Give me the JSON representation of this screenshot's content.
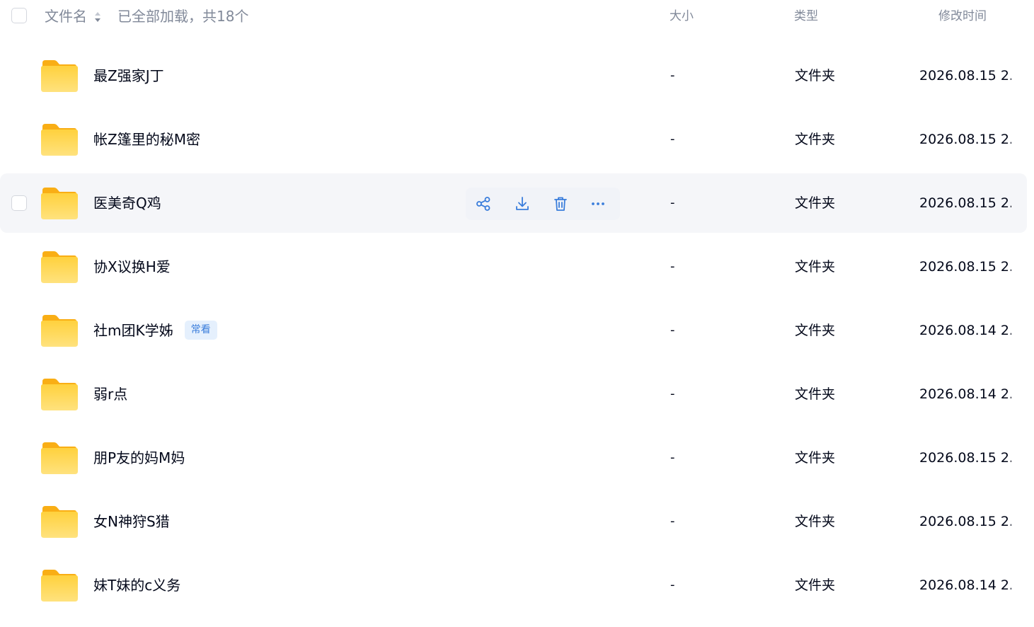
{
  "header": {
    "name_label": "文件名",
    "count_text": "已全部加载，共18个",
    "size_label": "大小",
    "type_label": "类型",
    "time_label": "修改时间"
  },
  "files": [
    {
      "name": "最Z强家J丁",
      "size": "-",
      "type": "文件夹",
      "modified": "2026.08.15 2..."
    },
    {
      "name": "帐Z篷里的秘M密",
      "size": "-",
      "type": "文件夹",
      "modified": "2026.08.15 2..."
    },
    {
      "name": "医美奇Q鸡",
      "size": "-",
      "type": "文件夹",
      "modified": "2026.08.15 2..."
    },
    {
      "name": "协X议换H爱",
      "size": "-",
      "type": "文件夹",
      "modified": "2026.08.15 2..."
    },
    {
      "name": "社m团K学姊",
      "badge": "常看",
      "size": "-",
      "type": "文件夹",
      "modified": "2026.08.14 2..."
    },
    {
      "name": "弱r点",
      "size": "-",
      "type": "文件夹",
      "modified": "2026.08.14 2..."
    },
    {
      "name": "朋P友的妈M妈",
      "size": "-",
      "type": "文件夹",
      "modified": "2026.08.15 2..."
    },
    {
      "name": "女N神狩S猎",
      "size": "-",
      "type": "文件夹",
      "modified": "2026.08.15 2..."
    },
    {
      "name": "妹T妹的c义务",
      "size": "-",
      "type": "文件夹",
      "modified": "2026.08.14 2..."
    }
  ],
  "hovered_row_index": 2,
  "row_actions": [
    "share-icon",
    "download-icon",
    "delete-icon",
    "more-icon"
  ],
  "colors": {
    "accent": "#3a7ddb",
    "folder": "#ffc72e",
    "hover_row": "#f5f6f9",
    "header_text": "#818999"
  }
}
